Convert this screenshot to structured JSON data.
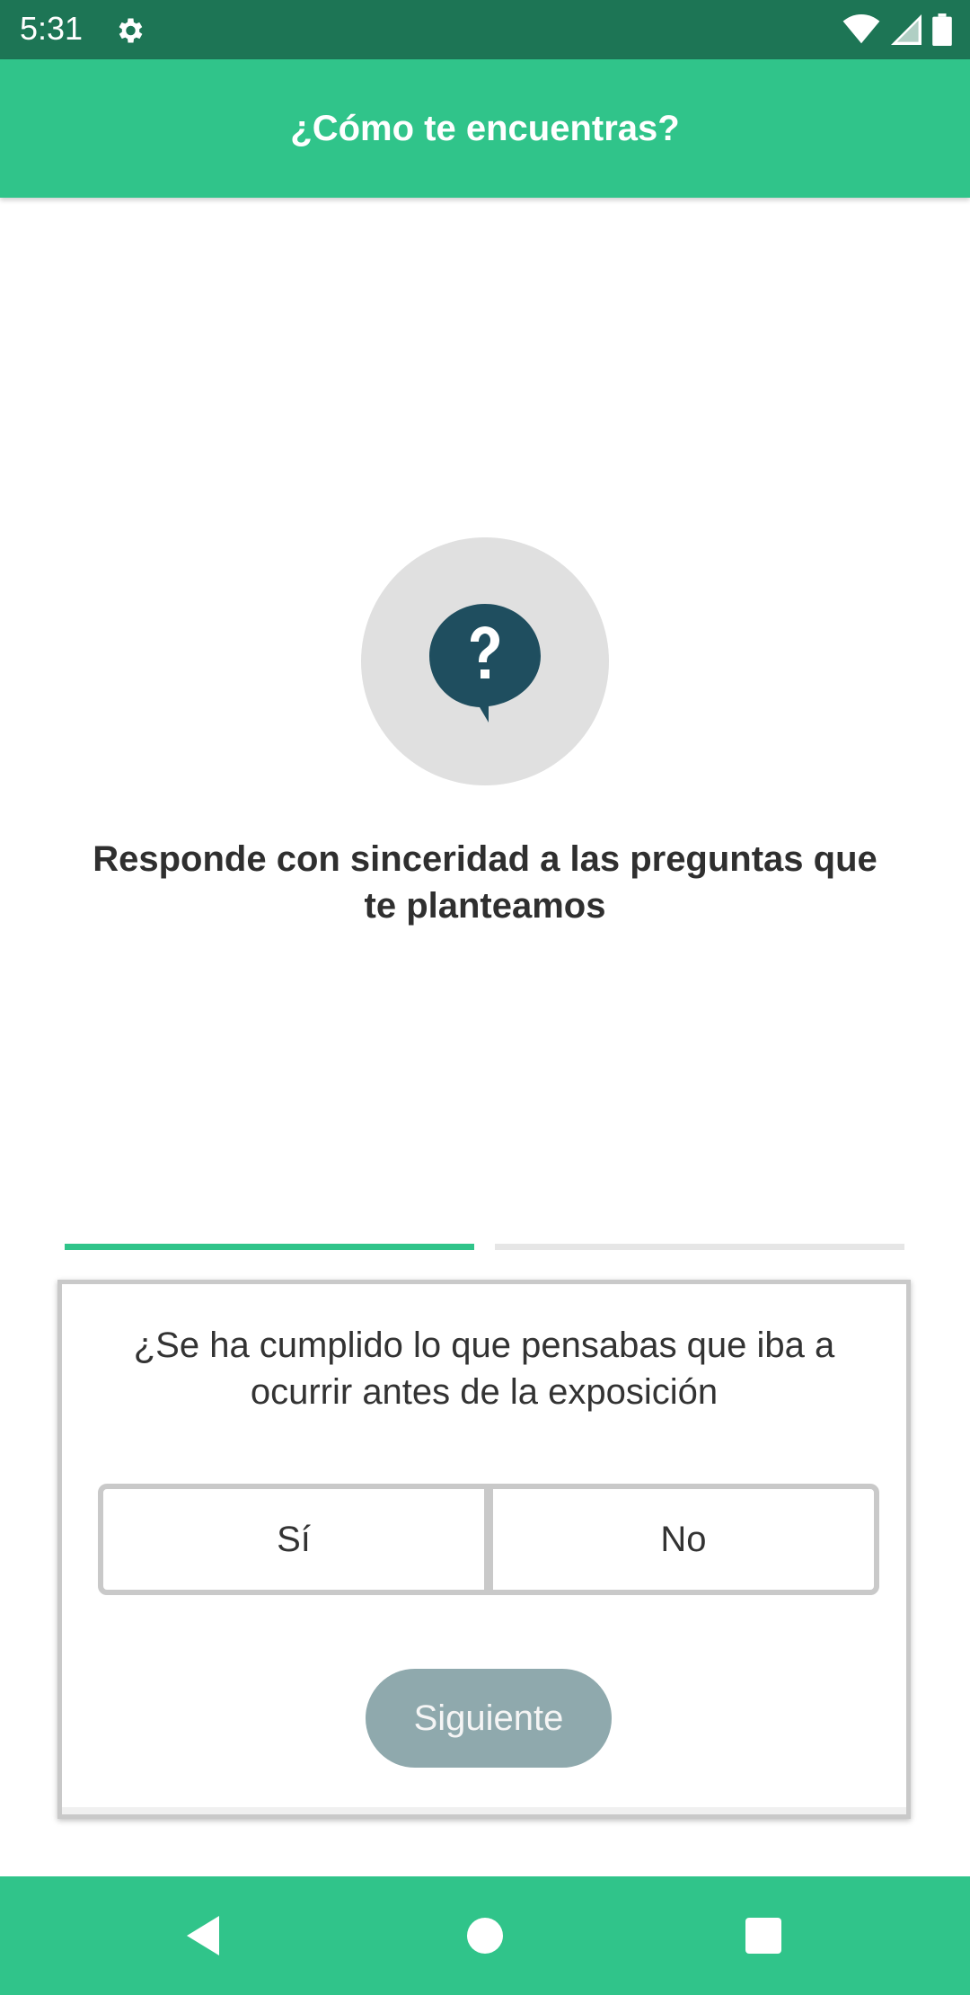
{
  "status_bar": {
    "time": "5:31",
    "icons": [
      "settings-icon",
      "wifi-icon",
      "signal-icon",
      "battery-icon"
    ]
  },
  "app_bar": {
    "title": "¿Cómo te encuentras?"
  },
  "hero": {
    "icon": "question-bubble-icon",
    "message": "Responde con sinceridad a las preguntas que te planteamos"
  },
  "progress": {
    "total_steps": 2,
    "current_step": 1
  },
  "question_card": {
    "question": "¿Se ha cumplido lo que pensabas que iba a ocurrir antes de la exposición",
    "options": [
      {
        "label": "Sí"
      },
      {
        "label": "No"
      }
    ],
    "next_label": "Siguiente"
  },
  "nav_bar": {
    "buttons": [
      "back-icon",
      "home-icon",
      "recents-icon"
    ]
  },
  "colors": {
    "status_bar": "#1d7555",
    "primary": "#30c48a",
    "icon_dark": "#1f4e5f",
    "hero_circle": "#e0e0e0",
    "button_disabled": "#8fa9ad"
  }
}
